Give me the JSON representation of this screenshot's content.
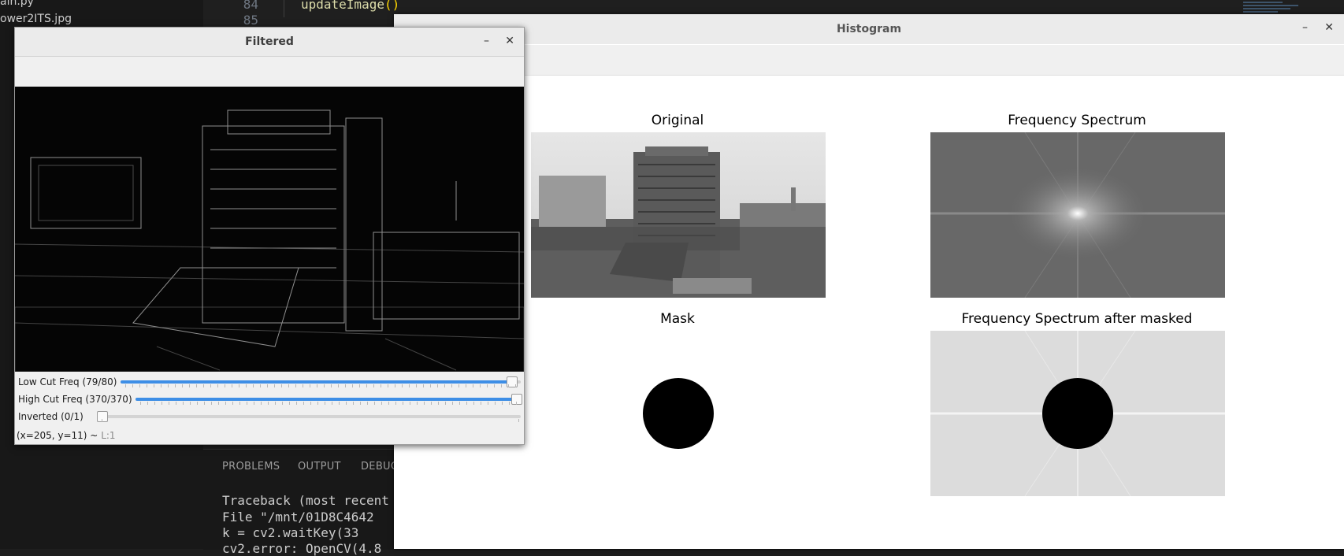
{
  "explorer": {
    "items": [
      "ain.py",
      "ower2ITS.jpg"
    ]
  },
  "editor": {
    "lines": [
      {
        "number": "84",
        "code": "updateImage",
        "paren": "()"
      },
      {
        "number": "85",
        "code": "",
        "paren": ""
      }
    ]
  },
  "panel": {
    "tabs": [
      "PROBLEMS",
      "OUTPUT",
      "DEBUG"
    ],
    "terminal": [
      "Traceback (most recent",
      "  File \"/mnt/01D8C4642",
      "    k = cv2.waitKey(33",
      "cv2.error: OpenCV(4.8"
    ]
  },
  "histogram_window": {
    "title": "Histogram",
    "minimize": "–",
    "close": "✕",
    "plots": [
      {
        "title": "Original"
      },
      {
        "title": "Frequency Spectrum"
      },
      {
        "title": "Mask"
      },
      {
        "title": "Frequency Spectrum after masked"
      }
    ]
  },
  "filtered_window": {
    "title": "Filtered",
    "minimize": "–",
    "close": "✕",
    "sliders": [
      {
        "label": "Low Cut Freq (79/80)",
        "value": 79,
        "max": 80
      },
      {
        "label": "High Cut Freq (370/370)",
        "value": 370,
        "max": 370
      },
      {
        "label": "Inverted   (0/1)",
        "value": 0,
        "max": 1
      }
    ],
    "status": {
      "coords": "(x=205, y=11) ~",
      "level": "L:1"
    }
  }
}
